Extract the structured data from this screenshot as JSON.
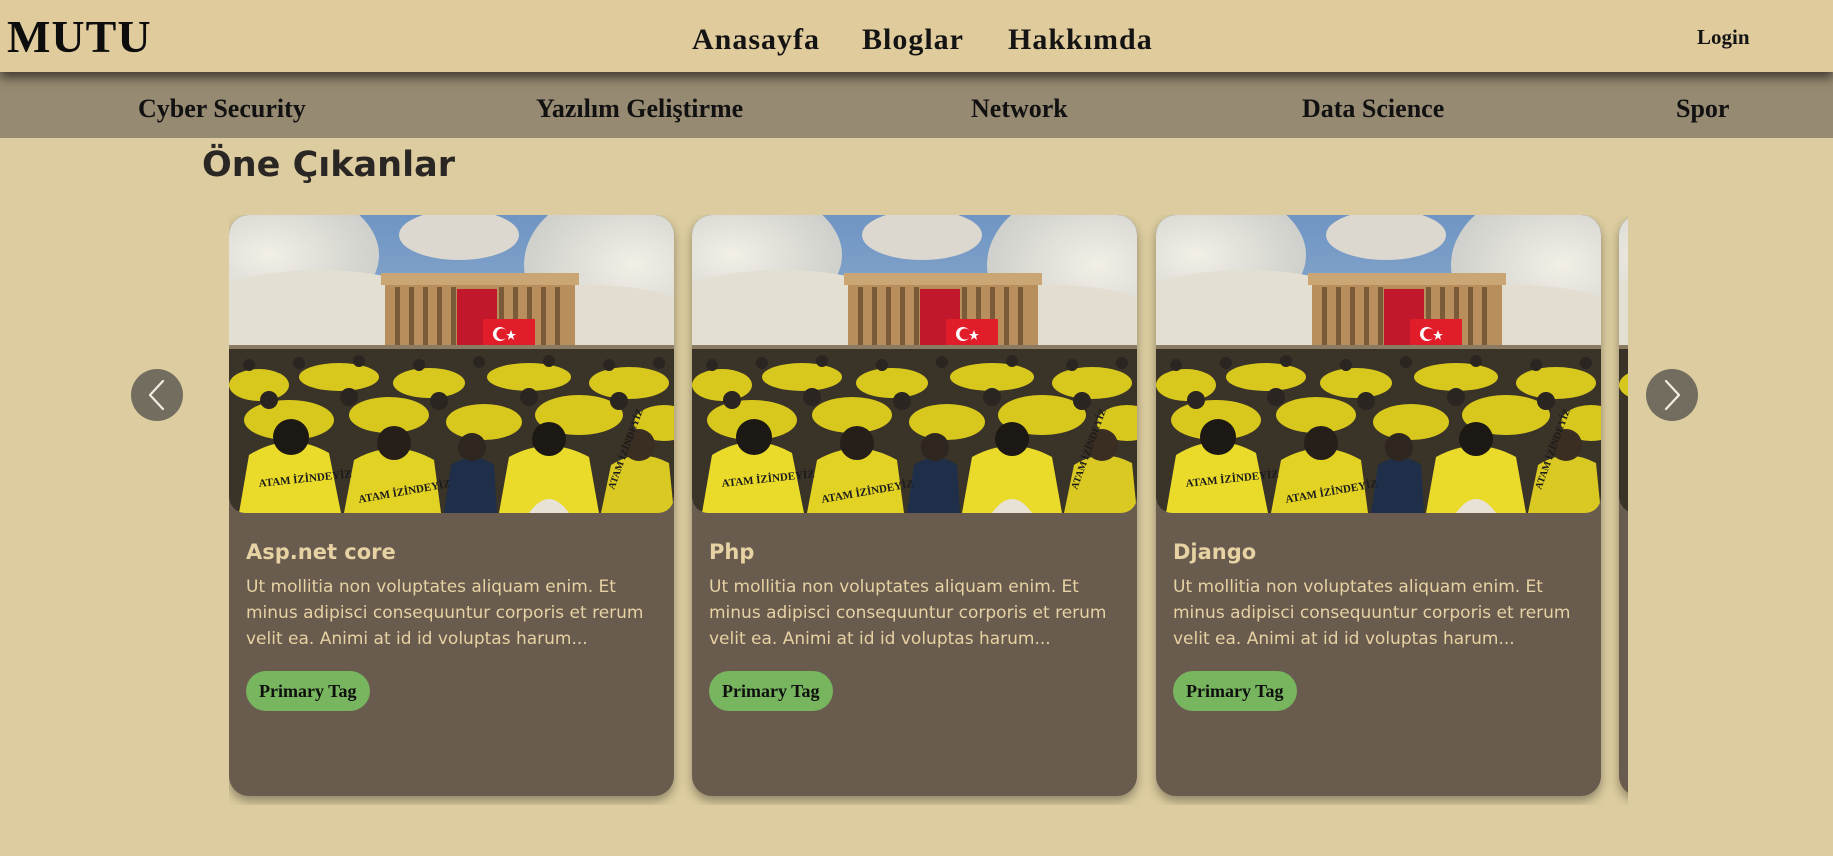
{
  "header": {
    "brand": "MUTU",
    "nav": [
      "Anasayfa",
      "Bloglar",
      "Hakkımda"
    ],
    "login": "Login"
  },
  "categories": [
    "Cyber Security",
    "Yazılım Geliştirme",
    "Network",
    "Data Science",
    "Spor"
  ],
  "featured": {
    "title": "Öne Çıkanlar",
    "cards": [
      {
        "title": "Asp.net core",
        "desc": "Ut mollitia non voluptates aliquam enim. Et minus adipisci consequuntur corporis et rerum velit ea. Animi at id id voluptas harum...",
        "tag": "Primary Tag"
      },
      {
        "title": "Php",
        "desc": "Ut mollitia non voluptates aliquam enim. Et minus adipisci consequuntur corporis et rerum velit ea. Animi at id id voluptas harum...",
        "tag": "Primary Tag"
      },
      {
        "title": "Django",
        "desc": "Ut mollitia non voluptates aliquam enim. Et minus adipisci consequuntur corporis et rerum velit ea. Animi at id id voluptas harum...",
        "tag": "Primary Tag"
      },
      {
        "title": "",
        "desc": "",
        "tag": ""
      }
    ],
    "banner_text": "ATAM İZİNDEYİZ",
    "prev_icon": "chevron-left-icon",
    "next_icon": "chevron-right-icon"
  },
  "colors": {
    "page_bg": "#dccc9f",
    "header_bg": "#e0cb9c",
    "category_bar_bg": "#978a72",
    "card_bg": "#695b4e",
    "card_text": "#e6d2a3",
    "tag_bg": "#77b55e",
    "arrow_bg": "#736d5f"
  }
}
